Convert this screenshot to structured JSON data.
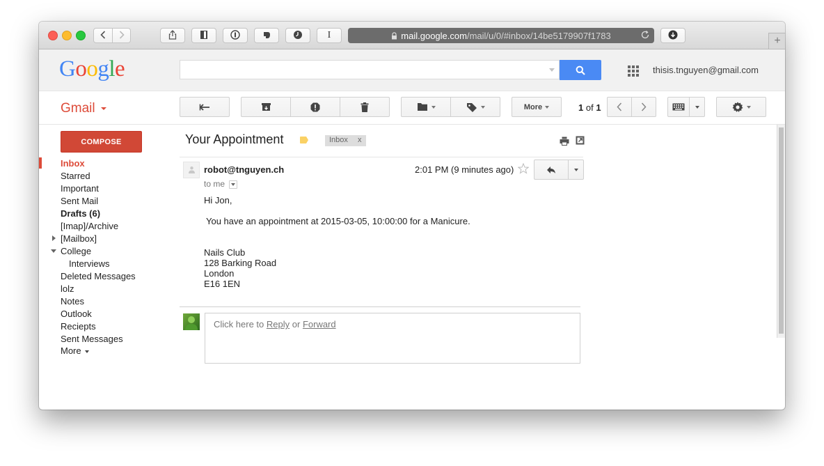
{
  "browser": {
    "url_host": "mail.google.com",
    "url_path": "/mail/u/0/#inbox/14be5179907f1783",
    "new_tab_label": "+"
  },
  "header": {
    "logo_text": "Google",
    "search_placeholder": "",
    "account": "thisis.tnguyen@gmail.com"
  },
  "actionbar": {
    "gmail_label": "Gmail",
    "more_label": "More",
    "pager_current": "1",
    "pager_of": "of",
    "pager_total": "1"
  },
  "sidebar": {
    "compose_label": "COMPOSE",
    "items": [
      {
        "label": "Inbox"
      },
      {
        "label": "Starred"
      },
      {
        "label": "Important"
      },
      {
        "label": "Sent Mail"
      },
      {
        "label": "Drafts (6)"
      },
      {
        "label": "[Imap]/Archive"
      },
      {
        "label": "[Mailbox]"
      },
      {
        "label": "College"
      },
      {
        "label": "Interviews"
      },
      {
        "label": "Deleted Messages"
      },
      {
        "label": "lolz"
      },
      {
        "label": "Notes"
      },
      {
        "label": "Outlook"
      },
      {
        "label": "Reciepts"
      },
      {
        "label": "Sent Messages"
      },
      {
        "label": "More"
      }
    ]
  },
  "message": {
    "subject": "Your Appointment",
    "label_chip": "Inbox",
    "label_chip_remove": "x",
    "sender": "robot@tnguyen.ch",
    "time": "2:01 PM (9 minutes ago)",
    "to": "to me",
    "greeting": "Hi Jon,",
    "line1": "You have an appointment at 2015-03-05, 10:00:00 for a Manicure.",
    "address": [
      "Nails Club",
      "128 Barking Road",
      "London",
      "E16 1EN"
    ]
  },
  "reply": {
    "prefix": "Click here to",
    "reply_link": "Reply",
    "or": "or",
    "forward_link": "Forward"
  },
  "colors": {
    "gmail_red": "#dd4b39",
    "compose_red": "#d14836",
    "search_blue": "#4a8af4",
    "label_yellow": "#fad165"
  }
}
